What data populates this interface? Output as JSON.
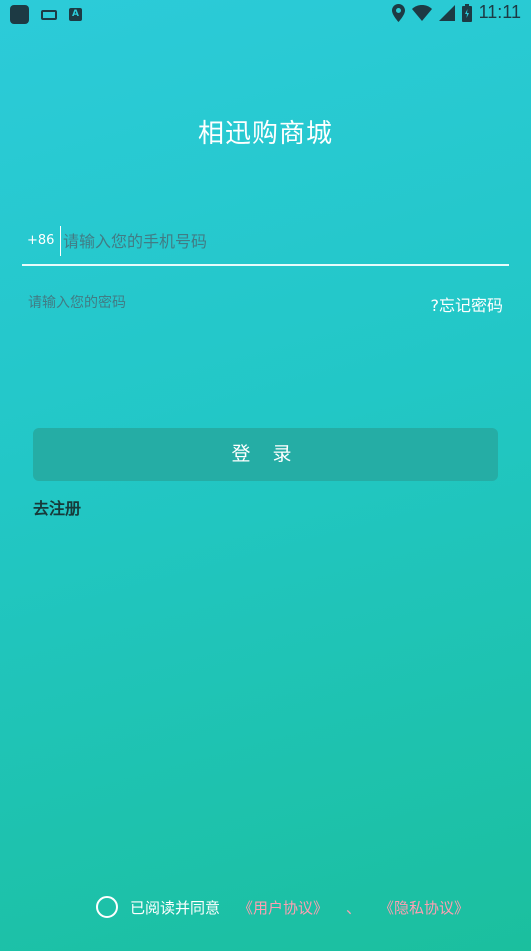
{
  "status_bar": {
    "time": "11:11",
    "icons": [
      "app-icon",
      "keyboard-icon",
      "a-icon",
      "location-icon",
      "wifi-icon",
      "signal-icon",
      "battery-icon"
    ]
  },
  "app_title": "相迅购商城",
  "phone": {
    "country_code": "+86",
    "placeholder": "请输入您的手机号码"
  },
  "password": {
    "placeholder": "请输入您的密码",
    "forgot_label": "?忘记密码"
  },
  "login_label": "登 录",
  "register_label": "去注册",
  "agreement": {
    "text": "已阅读并同意",
    "user_agreement": "《用户协议》",
    "separator": "、",
    "privacy_agreement": "《隐私协议》"
  },
  "colors": {
    "accent_button": "#25ada5",
    "link": "#ff9fb2",
    "gradient_top": "#2ccbd9",
    "gradient_bottom": "#1bbf9e"
  }
}
